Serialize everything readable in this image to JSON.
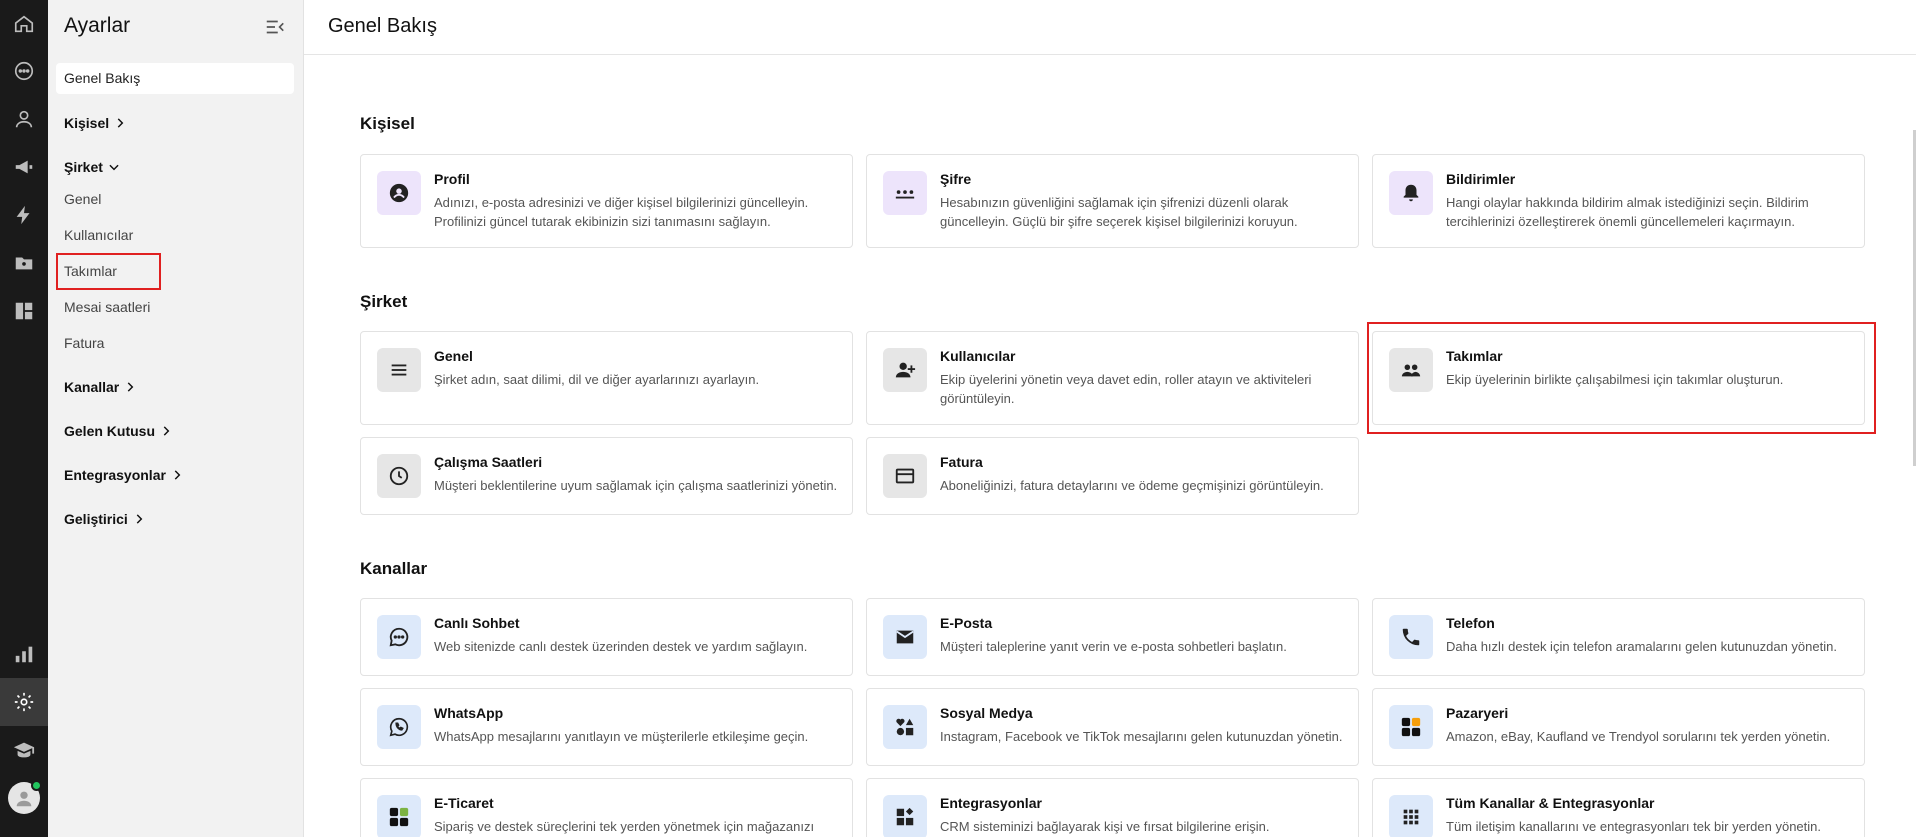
{
  "sidebar": {
    "title": "Ayarlar",
    "active": "Genel Bakış",
    "sections": {
      "kisisel": "Kişisel",
      "sirket": "Şirket",
      "kanallar": "Kanallar",
      "gelen_kutusu": "Gelen Kutusu",
      "entegrasyonlar": "Entegrasyonlar",
      "gelistirici": "Geliştirici"
    },
    "sirket_items": [
      "Genel",
      "Kullanıcılar",
      "Takımlar",
      "Mesai saatleri",
      "Fatura"
    ]
  },
  "header": {
    "title": "Genel Bakış"
  },
  "groups": {
    "kisisel": {
      "title": "Kişisel",
      "cards": [
        {
          "title": "Profil",
          "desc": "Adınızı, e-posta adresinizi ve diğer kişisel bilgilerinizi güncelleyin. Profilinizi güncel tutarak ekibinizin sizi tanımasını sağlayın.",
          "icon": "profile-icon"
        },
        {
          "title": "Şifre",
          "desc": "Hesabınızın güvenliğini sağlamak için şifrenizi düzenli olarak güncelleyin. Güçlü bir şifre seçerek kişisel bilgilerinizi koruyun.",
          "icon": "password-icon"
        },
        {
          "title": "Bildirimler",
          "desc": "Hangi olaylar hakkında bildirim almak istediğinizi seçin. Bildirim tercihlerinizi özelleştirerek önemli güncellemeleri kaçırmayın.",
          "icon": "bell-icon"
        }
      ]
    },
    "sirket": {
      "title": "Şirket",
      "cards": [
        {
          "title": "Genel",
          "desc": "Şirket adın, saat dilimi, dil ve diğer ayarlarınızı ayarlayın.",
          "icon": "menu-icon"
        },
        {
          "title": "Kullanıcılar",
          "desc": "Ekip üyelerini yönetin veya davet edin, roller atayın ve aktiviteleri görüntüleyin.",
          "icon": "person-add-icon"
        },
        {
          "title": "Takımlar",
          "desc": "Ekip üyelerinin birlikte çalışabilmesi için takımlar oluşturun.",
          "icon": "group-icon"
        },
        {
          "title": "Çalışma Saatleri",
          "desc": "Müşteri beklentilerine uyum sağlamak için çalışma saatlerinizi yönetin.",
          "icon": "clock-icon"
        },
        {
          "title": "Fatura",
          "desc": "Aboneliğinizi, fatura detaylarını ve ödeme geçmişinizi görüntüleyin.",
          "icon": "credit-card-icon"
        }
      ]
    },
    "kanallar": {
      "title": "Kanallar",
      "cards": [
        {
          "title": "Canlı Sohbet",
          "desc": "Web sitenizde canlı destek üzerinden destek ve yardım sağlayın.",
          "icon": "chat-icon"
        },
        {
          "title": "E-Posta",
          "desc": "Müşteri taleplerine yanıt verin ve e-posta sohbetleri başlatın.",
          "icon": "mail-icon"
        },
        {
          "title": "Telefon",
          "desc": "Daha hızlı destek için telefon aramalarını gelen kutunuzdan yönetin.",
          "icon": "phone-icon"
        },
        {
          "title": "WhatsApp",
          "desc": "WhatsApp mesajlarını yanıtlayın ve müşterilerle etkileşime geçin.",
          "icon": "whatsapp-icon"
        },
        {
          "title": "Sosyal Medya",
          "desc": "Instagram, Facebook ve TikTok mesajlarını gelen kutunuzdan yönetin.",
          "icon": "social-icon"
        },
        {
          "title": "Pazaryeri",
          "desc": "Amazon, eBay, Kaufland ve Trendyol sorularını tek yerden yönetin.",
          "icon": "marketplace-icon"
        },
        {
          "title": "E-Ticaret",
          "desc": "Sipariş ve destek süreçlerini tek yerden yönetmek için mağazanızı",
          "icon": "ecommerce-icon"
        },
        {
          "title": "Entegrasyonlar",
          "desc": "CRM sisteminizi bağlayarak kişi ve fırsat bilgilerine erişin.",
          "icon": "widgets-icon"
        },
        {
          "title": "Tüm Kanallar & Entegrasyonlar",
          "desc": "Tüm iletişim kanallarını ve entegrasyonları tek bir yerden yönetin.",
          "icon": "apps-grid-icon"
        }
      ]
    }
  }
}
